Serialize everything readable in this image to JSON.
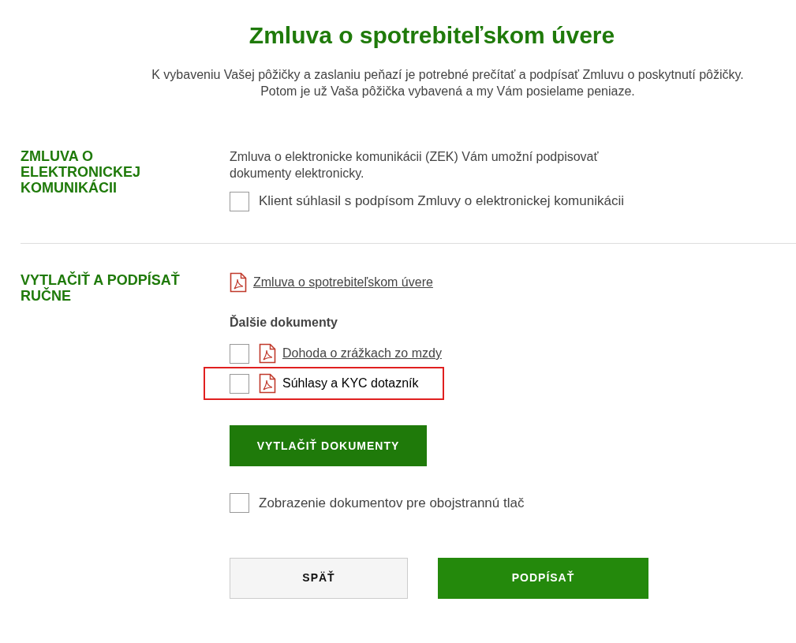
{
  "title": "Zmluva o spotrebiteľskom úvere",
  "intro": [
    "K vybaveniu Vašej pôžičky a zaslaniu peňazí je potrebné prečítať a podpísať Zmluvu o poskytnutí pôžičky.",
    "Potom je už Vaša pôžička vybavená a my Vám posielame peniaze."
  ],
  "electronic": {
    "heading": "ZMLUVA O ELEKTRONICKEJ KOMUNIKÁCII",
    "description": "Zmluva o elektronicke komunikácii (ZEK) Vám umožní podpisovať dokumenty elektronicky.",
    "consent": {
      "label": "Klient súhlasil s podpísom Zmluvy o elektronickej komunikácii",
      "checked": false
    }
  },
  "manual": {
    "heading": "VYTLAČIŤ A PODPÍSAŤ RUČNE",
    "main_document": "Zmluva o spotrebiteľskom úvere",
    "other_heading": "Ďalšie dokumenty",
    "documents": [
      {
        "label": "Dohoda o zrážkach zo mzdy",
        "checked": false,
        "highlighted": false
      },
      {
        "label": "Súhlasy a KYC dotazník",
        "checked": false,
        "highlighted": true
      }
    ],
    "print_button": "VYTLAČIŤ DOKUMENTY",
    "duplex": {
      "label": "Zobrazenie dokumentov pre obojstrannú tlač",
      "checked": false
    }
  },
  "buttons": {
    "back": "SPÄŤ",
    "sign": "PODPÍSAŤ"
  }
}
